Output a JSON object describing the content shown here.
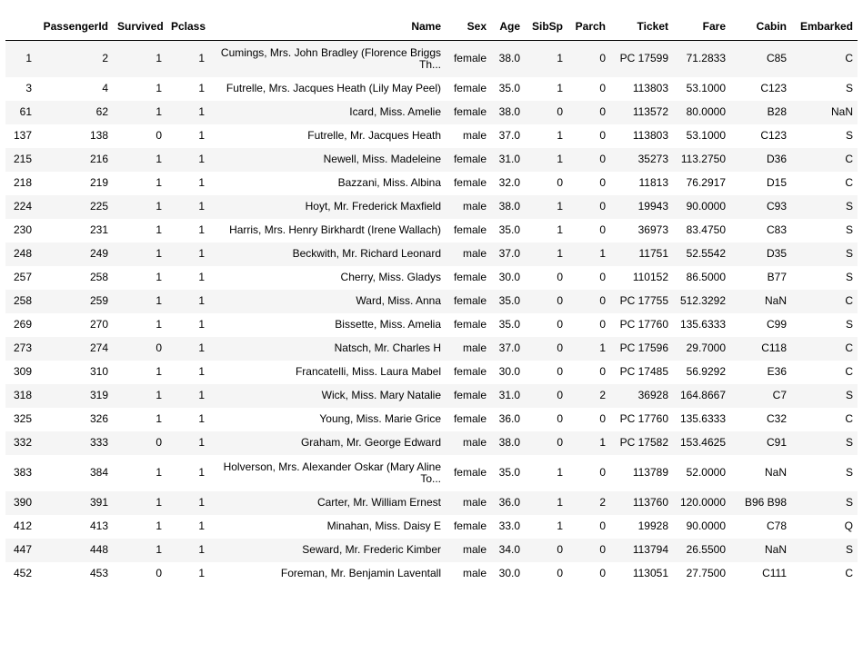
{
  "table": {
    "columns": [
      "",
      "PassengerId",
      "Survived",
      "Pclass",
      "Name",
      "Sex",
      "Age",
      "SibSp",
      "Parch",
      "Ticket",
      "Fare",
      "Cabin",
      "Embarked"
    ],
    "rows": [
      {
        "idx": "1",
        "cells": [
          "2",
          "1",
          "1",
          "Cumings, Mrs. John Bradley (Florence Briggs Th...",
          "female",
          "38.0",
          "1",
          "0",
          "PC 17599",
          "71.2833",
          "C85",
          "C"
        ]
      },
      {
        "idx": "3",
        "cells": [
          "4",
          "1",
          "1",
          "Futrelle, Mrs. Jacques Heath (Lily May Peel)",
          "female",
          "35.0",
          "1",
          "0",
          "113803",
          "53.1000",
          "C123",
          "S"
        ]
      },
      {
        "idx": "61",
        "cells": [
          "62",
          "1",
          "1",
          "Icard, Miss. Amelie",
          "female",
          "38.0",
          "0",
          "0",
          "113572",
          "80.0000",
          "B28",
          "NaN"
        ]
      },
      {
        "idx": "137",
        "cells": [
          "138",
          "0",
          "1",
          "Futrelle, Mr. Jacques Heath",
          "male",
          "37.0",
          "1",
          "0",
          "113803",
          "53.1000",
          "C123",
          "S"
        ]
      },
      {
        "idx": "215",
        "cells": [
          "216",
          "1",
          "1",
          "Newell, Miss. Madeleine",
          "female",
          "31.0",
          "1",
          "0",
          "35273",
          "113.2750",
          "D36",
          "C"
        ]
      },
      {
        "idx": "218",
        "cells": [
          "219",
          "1",
          "1",
          "Bazzani, Miss. Albina",
          "female",
          "32.0",
          "0",
          "0",
          "11813",
          "76.2917",
          "D15",
          "C"
        ]
      },
      {
        "idx": "224",
        "cells": [
          "225",
          "1",
          "1",
          "Hoyt, Mr. Frederick Maxfield",
          "male",
          "38.0",
          "1",
          "0",
          "19943",
          "90.0000",
          "C93",
          "S"
        ]
      },
      {
        "idx": "230",
        "cells": [
          "231",
          "1",
          "1",
          "Harris, Mrs. Henry Birkhardt (Irene Wallach)",
          "female",
          "35.0",
          "1",
          "0",
          "36973",
          "83.4750",
          "C83",
          "S"
        ]
      },
      {
        "idx": "248",
        "cells": [
          "249",
          "1",
          "1",
          "Beckwith, Mr. Richard Leonard",
          "male",
          "37.0",
          "1",
          "1",
          "11751",
          "52.5542",
          "D35",
          "S"
        ]
      },
      {
        "idx": "257",
        "cells": [
          "258",
          "1",
          "1",
          "Cherry, Miss. Gladys",
          "female",
          "30.0",
          "0",
          "0",
          "110152",
          "86.5000",
          "B77",
          "S"
        ]
      },
      {
        "idx": "258",
        "cells": [
          "259",
          "1",
          "1",
          "Ward, Miss. Anna",
          "female",
          "35.0",
          "0",
          "0",
          "PC 17755",
          "512.3292",
          "NaN",
          "C"
        ]
      },
      {
        "idx": "269",
        "cells": [
          "270",
          "1",
          "1",
          "Bissette, Miss. Amelia",
          "female",
          "35.0",
          "0",
          "0",
          "PC 17760",
          "135.6333",
          "C99",
          "S"
        ]
      },
      {
        "idx": "273",
        "cells": [
          "274",
          "0",
          "1",
          "Natsch, Mr. Charles H",
          "male",
          "37.0",
          "0",
          "1",
          "PC 17596",
          "29.7000",
          "C118",
          "C"
        ]
      },
      {
        "idx": "309",
        "cells": [
          "310",
          "1",
          "1",
          "Francatelli, Miss. Laura Mabel",
          "female",
          "30.0",
          "0",
          "0",
          "PC 17485",
          "56.9292",
          "E36",
          "C"
        ]
      },
      {
        "idx": "318",
        "cells": [
          "319",
          "1",
          "1",
          "Wick, Miss. Mary Natalie",
          "female",
          "31.0",
          "0",
          "2",
          "36928",
          "164.8667",
          "C7",
          "S"
        ]
      },
      {
        "idx": "325",
        "cells": [
          "326",
          "1",
          "1",
          "Young, Miss. Marie Grice",
          "female",
          "36.0",
          "0",
          "0",
          "PC 17760",
          "135.6333",
          "C32",
          "C"
        ]
      },
      {
        "idx": "332",
        "cells": [
          "333",
          "0",
          "1",
          "Graham, Mr. George Edward",
          "male",
          "38.0",
          "0",
          "1",
          "PC 17582",
          "153.4625",
          "C91",
          "S"
        ]
      },
      {
        "idx": "383",
        "cells": [
          "384",
          "1",
          "1",
          "Holverson, Mrs. Alexander Oskar (Mary Aline To...",
          "female",
          "35.0",
          "1",
          "0",
          "113789",
          "52.0000",
          "NaN",
          "S"
        ]
      },
      {
        "idx": "390",
        "cells": [
          "391",
          "1",
          "1",
          "Carter, Mr. William Ernest",
          "male",
          "36.0",
          "1",
          "2",
          "113760",
          "120.0000",
          "B96 B98",
          "S"
        ]
      },
      {
        "idx": "412",
        "cells": [
          "413",
          "1",
          "1",
          "Minahan, Miss. Daisy E",
          "female",
          "33.0",
          "1",
          "0",
          "19928",
          "90.0000",
          "C78",
          "Q"
        ]
      },
      {
        "idx": "447",
        "cells": [
          "448",
          "1",
          "1",
          "Seward, Mr. Frederic Kimber",
          "male",
          "34.0",
          "0",
          "0",
          "113794",
          "26.5500",
          "NaN",
          "S"
        ]
      },
      {
        "idx": "452",
        "cells": [
          "453",
          "0",
          "1",
          "Foreman, Mr. Benjamin Laventall",
          "male",
          "30.0",
          "0",
          "0",
          "113051",
          "27.7500",
          "C111",
          "C"
        ]
      }
    ]
  }
}
